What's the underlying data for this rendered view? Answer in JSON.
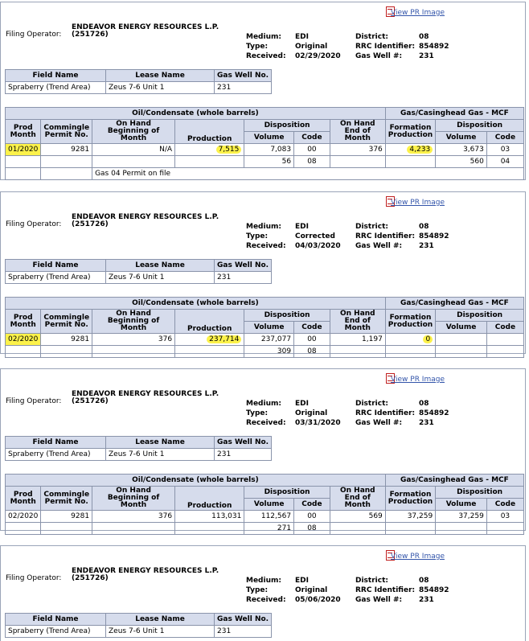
{
  "reports": [
    {
      "view_link": "View PR Image",
      "operator_label": "Filing Operator:",
      "operator_name": "ENDEAVOR ENERGY RESOURCES L.P.",
      "operator_id": "(251726)",
      "medium_label": "Medium:",
      "medium": "EDI",
      "type_label": "Type:",
      "type": "Original",
      "received_label": "Received:",
      "received": "02/29/2020",
      "district_label": "District:",
      "district": "08",
      "rrc_label": "RRC Identifier:",
      "rrc": "854892",
      "gaswell_label": "Gas Well #:",
      "gaswell": "231",
      "field_name_hdr": "Field Name",
      "lease_name_hdr": "Lease Name",
      "gas_well_no_hdr": "Gas Well No.",
      "field_name": "Spraberry (Trend Area)",
      "lease_name": "Zeus 7-6 Unit 1",
      "gas_well_no": "231",
      "prod": {
        "oil_hdr": "Oil/Condensate (whole barrels)",
        "gas_hdr": "Gas/Casinghead Gas - MCF",
        "prod_month": "Prod Month",
        "commingle": "Commingle Permit No.",
        "onhand_begin": "On Hand Beginning of Month",
        "production": "Production",
        "disposition": "Disposition",
        "volume": "Volume",
        "code": "Code",
        "onhand_end": "On Hand End of Month",
        "formation": "Formation Production",
        "month": "01/2020",
        "permit": "9281",
        "begin": "N/A",
        "production_val": "7,515",
        "disp1_vol": "7,083",
        "disp1_code": "00",
        "end": "376",
        "formation_val": "4,233",
        "gas1_vol": "3,673",
        "gas1_code": "03",
        "disp2_vol": "56",
        "disp2_code": "08",
        "gas2_vol": "560",
        "gas2_code": "04",
        "note": "Gas 04 Permit on file"
      }
    },
    {
      "view_link": "View PR Image",
      "operator_label": "Filing Operator:",
      "operator_name": "ENDEAVOR ENERGY RESOURCES L.P.",
      "operator_id": "(251726)",
      "medium_label": "Medium:",
      "medium": "EDI",
      "type_label": "Type:",
      "type": "Corrected",
      "received_label": "Received:",
      "received": "04/03/2020",
      "district_label": "District:",
      "district": "08",
      "rrc_label": "RRC Identifier:",
      "rrc": "854892",
      "gaswell_label": "Gas Well #:",
      "gaswell": "231",
      "field_name_hdr": "Field Name",
      "lease_name_hdr": "Lease Name",
      "gas_well_no_hdr": "Gas Well No.",
      "field_name": "Spraberry (Trend Area)",
      "lease_name": "Zeus 7-6 Unit 1",
      "gas_well_no": "231",
      "prod": {
        "oil_hdr": "Oil/Condensate (whole barrels)",
        "gas_hdr": "Gas/Casinghead Gas - MCF",
        "prod_month": "Prod Month",
        "commingle": "Commingle Permit No.",
        "onhand_begin": "On Hand Beginning of Month",
        "production": "Production",
        "disposition": "Disposition",
        "volume": "Volume",
        "code": "Code",
        "onhand_end": "On Hand End of Month",
        "formation": "Formation Production",
        "month": "02/2020",
        "permit": "9281",
        "begin": "376",
        "production_val": "237,714",
        "disp1_vol": "237,077",
        "disp1_code": "00",
        "end": "1,197",
        "formation_val": "0",
        "gas1_vol": "",
        "gas1_code": "",
        "disp2_vol": "309",
        "disp2_code": "08",
        "gas2_vol": "",
        "gas2_code": ""
      }
    },
    {
      "view_link": "View PR Image",
      "operator_label": "Filing Operator:",
      "operator_name": "ENDEAVOR ENERGY RESOURCES L.P.",
      "operator_id": "(251726)",
      "medium_label": "Medium:",
      "medium": "EDI",
      "type_label": "Type:",
      "type": "Original",
      "received_label": "Received:",
      "received": "03/31/2020",
      "district_label": "District:",
      "district": "08",
      "rrc_label": "RRC Identifier:",
      "rrc": "854892",
      "gaswell_label": "Gas Well #:",
      "gaswell": "231",
      "field_name_hdr": "Field Name",
      "lease_name_hdr": "Lease Name",
      "gas_well_no_hdr": "Gas Well No.",
      "field_name": "Spraberry (Trend Area)",
      "lease_name": "Zeus 7-6 Unit 1",
      "gas_well_no": "231",
      "prod": {
        "oil_hdr": "Oil/Condensate (whole barrels)",
        "gas_hdr": "Gas/Casinghead Gas - MCF",
        "prod_month": "Prod Month",
        "commingle": "Commingle Permit No.",
        "onhand_begin": "On Hand Beginning of Month",
        "production": "Production",
        "disposition": "Disposition",
        "volume": "Volume",
        "code": "Code",
        "onhand_end": "On Hand End of Month",
        "formation": "Formation Production",
        "month": "02/2020",
        "permit": "9281",
        "begin": "376",
        "production_val": "113,031",
        "disp1_vol": "112,567",
        "disp1_code": "00",
        "end": "569",
        "formation_val": "37,259",
        "gas1_vol": "37,259",
        "gas1_code": "03",
        "disp2_vol": "271",
        "disp2_code": "08",
        "gas2_vol": "",
        "gas2_code": ""
      }
    },
    {
      "view_link": "View PR Image",
      "operator_label": "Filing Operator:",
      "operator_name": "ENDEAVOR ENERGY RESOURCES L.P.",
      "operator_id": "(251726)",
      "medium_label": "Medium:",
      "medium": "EDI",
      "type_label": "Type:",
      "type": "Original",
      "received_label": "Received:",
      "received": "05/06/2020",
      "district_label": "District:",
      "district": "08",
      "rrc_label": "RRC Identifier:",
      "rrc": "854892",
      "gaswell_label": "Gas Well #:",
      "gaswell": "231",
      "field_name_hdr": "Field Name",
      "lease_name_hdr": "Lease Name",
      "gas_well_no_hdr": "Gas Well No.",
      "field_name": "Spraberry (Trend Area)",
      "lease_name": "Zeus 7-6 Unit 1",
      "gas_well_no": "231"
    }
  ]
}
